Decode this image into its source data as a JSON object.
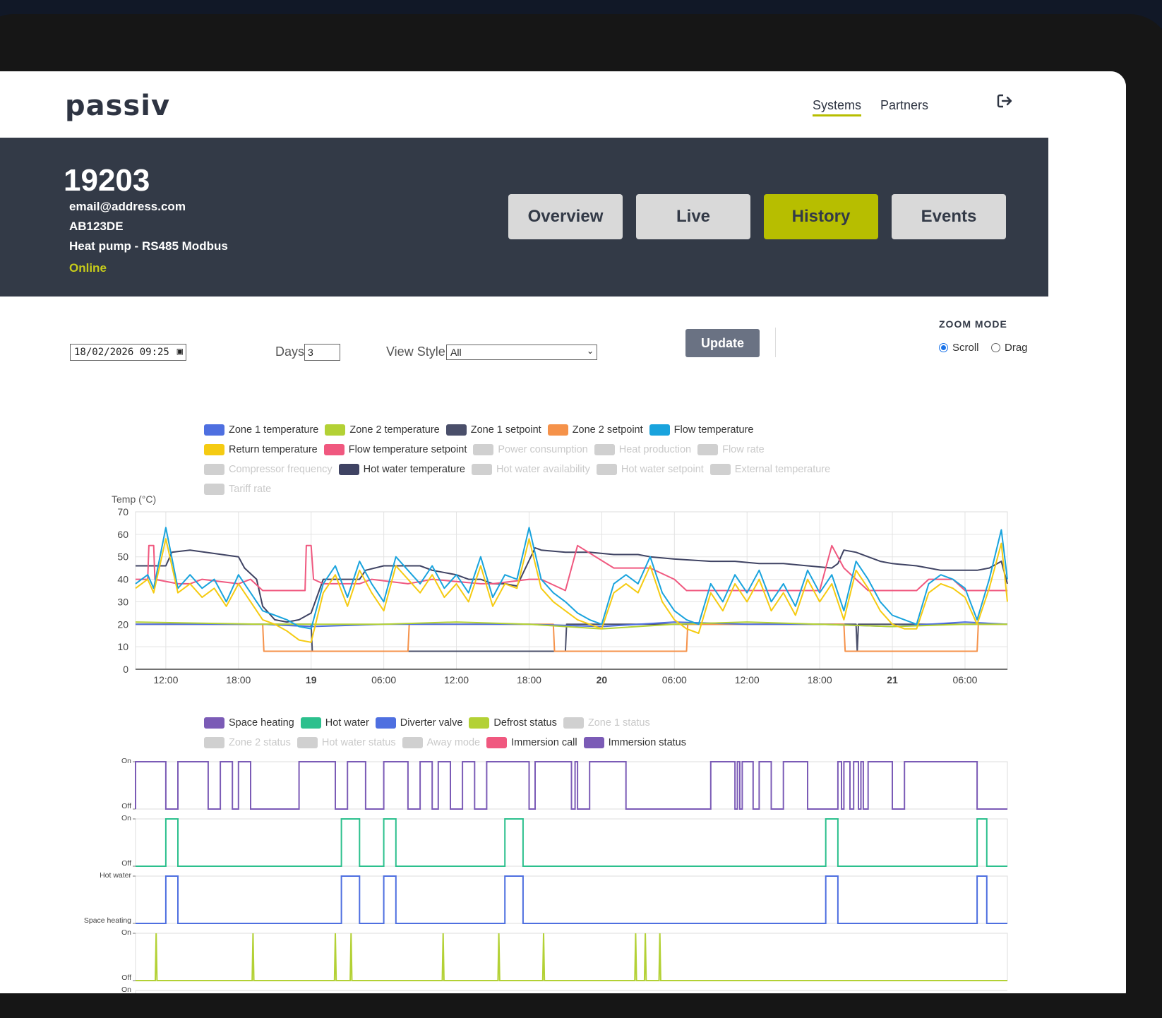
{
  "app": {
    "logo": "passiv"
  },
  "nav": {
    "systems": "Systems",
    "partners": "Partners",
    "logout_icon": "logout-icon"
  },
  "system": {
    "id": "19203",
    "email": "email@address.com",
    "postcode": "AB123DE",
    "device": "Heat pump - RS485 Modbus",
    "status": "Online"
  },
  "tabs": [
    {
      "label": "Overview",
      "active": false
    },
    {
      "label": "Live",
      "active": false
    },
    {
      "label": "History",
      "active": true
    },
    {
      "label": "Events",
      "active": false
    }
  ],
  "controls": {
    "date_value": "18/02/2026 09:25",
    "days_label": "Days",
    "days_value": "3",
    "view_style_label": "View Style",
    "view_style_value": "All",
    "update_label": "Update",
    "zoom_mode_title": "ZOOM MODE",
    "zoom_scroll": "Scroll",
    "zoom_drag": "Drag",
    "zoom_selected": "Scroll"
  },
  "colors": {
    "accent": "#b7be00",
    "header_bg": "#333a47"
  },
  "temp_legend": [
    {
      "label": "Zone 1 temperature",
      "color": "#4e6fe0",
      "on": true
    },
    {
      "label": "Zone 2 temperature",
      "color": "#b3d135",
      "on": true
    },
    {
      "label": "Zone 1 setpoint",
      "color": "#4a4f6a",
      "on": true
    },
    {
      "label": "Zone 2 setpoint",
      "color": "#f5924a",
      "on": true
    },
    {
      "label": "Flow temperature",
      "color": "#19a3dd",
      "on": true
    },
    {
      "label": "Return temperature",
      "color": "#f5cb12",
      "on": true
    },
    {
      "label": "Flow temperature setpoint",
      "color": "#f0587f",
      "on": true
    },
    {
      "label": "Power consumption",
      "color": "#d0d0d0",
      "on": false
    },
    {
      "label": "Heat production",
      "color": "#d0d0d0",
      "on": false
    },
    {
      "label": "Flow rate",
      "color": "#d0d0d0",
      "on": false
    },
    {
      "label": "Compressor frequency",
      "color": "#d0d0d0",
      "on": false
    },
    {
      "label": "Hot water temperature",
      "color": "#3f4363",
      "on": true
    },
    {
      "label": "Hot water availability",
      "color": "#d0d0d0",
      "on": false
    },
    {
      "label": "Hot water setpoint",
      "color": "#d0d0d0",
      "on": false
    },
    {
      "label": "External temperature",
      "color": "#d0d0d0",
      "on": false
    },
    {
      "label": "Tariff rate",
      "color": "#d0d0d0",
      "on": false
    }
  ],
  "status_legend": [
    {
      "label": "Space heating",
      "color": "#7b5bb6",
      "on": true
    },
    {
      "label": "Hot water",
      "color": "#2cc08d",
      "on": true
    },
    {
      "label": "Diverter valve",
      "color": "#4e6fe0",
      "on": true
    },
    {
      "label": "Defrost status",
      "color": "#b3d135",
      "on": true
    },
    {
      "label": "Zone 1 status",
      "color": "#d0d0d0",
      "on": false
    },
    {
      "label": "Zone 2 status",
      "color": "#d0d0d0",
      "on": false
    },
    {
      "label": "Hot water status",
      "color": "#d0d0d0",
      "on": false
    },
    {
      "label": "Away mode",
      "color": "#d0d0d0",
      "on": false
    },
    {
      "label": "Immersion call",
      "color": "#f0587f",
      "on": true
    },
    {
      "label": "Immersion status",
      "color": "#7b5bb6",
      "on": true
    }
  ],
  "chart_data": [
    {
      "type": "line",
      "ylabel": "Temp (°C)",
      "ylim": [
        0,
        70
      ],
      "yticks": [
        0,
        10,
        20,
        30,
        40,
        50,
        60,
        70
      ],
      "xticks": [
        {
          "label": "12:00",
          "bold": false
        },
        {
          "label": "18:00",
          "bold": false
        },
        {
          "label": "19",
          "bold": true
        },
        {
          "label": "06:00",
          "bold": false
        },
        {
          "label": "12:00",
          "bold": false
        },
        {
          "label": "18:00",
          "bold": false
        },
        {
          "label": "20",
          "bold": true
        },
        {
          "label": "06:00",
          "bold": false
        },
        {
          "label": "12:00",
          "bold": false
        },
        {
          "label": "18:00",
          "bold": false
        },
        {
          "label": "21",
          "bold": true
        },
        {
          "label": "06:00",
          "bold": false
        }
      ],
      "x_hours_from_12": [
        0,
        6,
        12,
        18,
        24,
        30,
        36,
        42,
        48,
        54,
        60,
        66
      ],
      "x_range_hours": [
        -2.5,
        69.5
      ],
      "grid": true,
      "series": [
        {
          "name": "Hot water temperature",
          "color": "#3f4363",
          "x": [
            -2.5,
            0,
            0.5,
            2,
            6,
            6.5,
            7.5,
            8,
            9,
            10,
            11,
            12,
            13,
            16,
            16.5,
            18,
            19,
            21,
            22,
            24,
            25,
            26,
            27,
            28,
            29,
            30.5,
            31,
            33,
            35,
            37,
            39,
            40,
            42,
            45,
            47,
            49,
            51,
            53,
            55,
            55.5,
            56,
            57,
            58,
            59,
            60,
            62,
            63,
            64,
            66,
            67,
            68,
            69,
            69.5
          ],
          "y": [
            46,
            46,
            52,
            53,
            50,
            45,
            40,
            28,
            22,
            21,
            22,
            25,
            40,
            40,
            44,
            46,
            46,
            46,
            44,
            42,
            40,
            40,
            38,
            38,
            37,
            54,
            53,
            52,
            52,
            51,
            51,
            50,
            49,
            48,
            48,
            47,
            47,
            46,
            45,
            47,
            53,
            52,
            50,
            48,
            47,
            46,
            45,
            44,
            44,
            44,
            45,
            48,
            38
          ]
        },
        {
          "name": "Zone 1 setpoint",
          "color": "#4a4f6a",
          "x": [
            -2.5,
            12,
            12.1,
            33,
            33.1,
            33.2,
            36,
            57,
            57.1,
            57.2,
            69.5
          ],
          "y": [
            20,
            20,
            8,
            8,
            20,
            20,
            20,
            20,
            8,
            20,
            20
          ]
        },
        {
          "name": "Zone 2 setpoint",
          "color": "#f5924a",
          "x": [
            -2.5,
            8,
            8.1,
            20,
            20.1,
            32,
            32.1,
            43,
            43.1,
            56,
            56.1,
            67,
            67.1,
            69.5
          ],
          "y": [
            20,
            20,
            8,
            8,
            20,
            20,
            8,
            8,
            20,
            20,
            8,
            8,
            20,
            20
          ]
        },
        {
          "name": "Zone 1 temperature",
          "color": "#4e6fe0",
          "x": [
            -2.5,
            8,
            12,
            18,
            24,
            30,
            36,
            42,
            48,
            54,
            60,
            66,
            69.5
          ],
          "y": [
            20,
            20,
            19,
            20,
            20,
            20,
            19,
            21,
            20,
            20,
            19,
            21,
            20
          ]
        },
        {
          "name": "Zone 2 temperature",
          "color": "#b3d135",
          "x": [
            -2.5,
            8,
            12,
            18,
            24,
            30,
            36,
            42,
            48,
            54,
            60,
            66,
            69.5
          ],
          "y": [
            21,
            20,
            20,
            20,
            21,
            20,
            18,
            20,
            21,
            20,
            19,
            20,
            20
          ]
        },
        {
          "name": "Flow temperature setpoint",
          "color": "#f0587f",
          "x": [
            -2.5,
            -1.5,
            -1.4,
            -1,
            -0.9,
            1,
            2,
            3,
            6,
            7,
            8,
            11.5,
            11.6,
            12,
            12.2,
            13,
            16,
            17,
            20,
            21,
            22,
            26,
            27,
            30,
            31,
            33,
            34,
            37,
            40,
            42,
            43,
            48,
            50,
            54,
            55,
            56,
            58,
            60,
            61,
            62,
            63,
            64,
            65,
            66,
            67,
            68,
            69.5
          ],
          "y": [
            40,
            40,
            55,
            55,
            40,
            38,
            38,
            40,
            38,
            40,
            35,
            35,
            55,
            55,
            40,
            38,
            38,
            40,
            38,
            39,
            40,
            38,
            38,
            40,
            40,
            35,
            55,
            45,
            45,
            40,
            35,
            35,
            35,
            35,
            55,
            45,
            35,
            35,
            35,
            35,
            40,
            40,
            40,
            35,
            35,
            35,
            35
          ]
        },
        {
          "name": "Flow temperature",
          "color": "#19a3dd",
          "x": [
            -2.5,
            -1.5,
            -1,
            0,
            1,
            2,
            3,
            4,
            5,
            6,
            7,
            8,
            9,
            10,
            11,
            12,
            13,
            14,
            15,
            16,
            17,
            18,
            19,
            20,
            21,
            22,
            23,
            24,
            25,
            26,
            27,
            28,
            29,
            30,
            31,
            32,
            33,
            34,
            35,
            36,
            37,
            38,
            39,
            40,
            41,
            42,
            43,
            44,
            45,
            46,
            47,
            48,
            49,
            50,
            51,
            52,
            53,
            54,
            55,
            56,
            57,
            58,
            59,
            60,
            61,
            62,
            63,
            64,
            65,
            66,
            67,
            68,
            69,
            69.5
          ],
          "y": [
            38,
            42,
            36,
            63,
            36,
            42,
            36,
            40,
            30,
            42,
            34,
            26,
            24,
            22,
            19,
            18,
            38,
            46,
            32,
            48,
            38,
            30,
            50,
            44,
            38,
            46,
            36,
            42,
            34,
            50,
            32,
            42,
            40,
            63,
            40,
            34,
            30,
            25,
            22,
            20,
            38,
            42,
            38,
            50,
            34,
            26,
            22,
            20,
            38,
            30,
            42,
            34,
            44,
            30,
            38,
            28,
            44,
            34,
            42,
            26,
            48,
            40,
            30,
            24,
            22,
            20,
            38,
            42,
            40,
            36,
            22,
            40,
            62,
            40
          ]
        },
        {
          "name": "Return temperature",
          "color": "#f5cb12",
          "x": [
            -2.5,
            -1.5,
            -1,
            0,
            1,
            2,
            3,
            4,
            5,
            6,
            7,
            8,
            9,
            10,
            11,
            12,
            13,
            14,
            15,
            16,
            17,
            18,
            19,
            20,
            21,
            22,
            23,
            24,
            25,
            26,
            27,
            28,
            29,
            30,
            31,
            32,
            33,
            34,
            35,
            36,
            37,
            38,
            39,
            40,
            41,
            42,
            43,
            44,
            45,
            46,
            47,
            48,
            49,
            50,
            51,
            52,
            53,
            54,
            55,
            56,
            57,
            58,
            59,
            60,
            61,
            62,
            63,
            64,
            65,
            66,
            67,
            68,
            69,
            69.5
          ],
          "y": [
            36,
            40,
            34,
            58,
            34,
            38,
            32,
            36,
            28,
            38,
            30,
            22,
            20,
            17,
            13,
            12,
            34,
            42,
            28,
            44,
            34,
            26,
            46,
            40,
            34,
            42,
            32,
            38,
            30,
            46,
            28,
            38,
            36,
            58,
            36,
            30,
            26,
            22,
            20,
            18,
            34,
            38,
            34,
            46,
            30,
            22,
            18,
            16,
            34,
            26,
            38,
            30,
            40,
            26,
            34,
            24,
            40,
            30,
            38,
            22,
            44,
            36,
            26,
            20,
            18,
            18,
            34,
            38,
            36,
            32,
            20,
            36,
            56,
            30
          ]
        }
      ]
    },
    {
      "type": "line",
      "title": "Space heating",
      "ylabels": [
        "On",
        "Off"
      ],
      "x_range_hours": [
        -2.5,
        69.5
      ],
      "series": [
        {
          "name": "Space heating",
          "color": "#7b5bb6",
          "on_intervals": [
            [
              -2.5,
              0
            ],
            [
              1,
              3.5
            ],
            [
              4.5,
              5.5
            ],
            [
              6,
              7
            ],
            [
              11,
              14
            ],
            [
              15,
              16.5
            ],
            [
              18,
              20
            ],
            [
              21,
              22
            ],
            [
              22.5,
              23.5
            ],
            [
              24.5,
              25.5
            ],
            [
              26.5,
              30
            ],
            [
              30.5,
              33.5
            ],
            [
              33.8,
              34
            ],
            [
              35,
              38
            ],
            [
              45,
              47
            ],
            [
              47.2,
              47.4
            ],
            [
              47.6,
              48.5
            ],
            [
              49,
              50
            ],
            [
              51,
              53
            ],
            [
              55.5,
              55.8
            ],
            [
              56,
              56.5
            ],
            [
              56.8,
              57.2
            ],
            [
              57.4,
              57.6
            ],
            [
              58,
              60
            ],
            [
              61,
              67
            ]
          ]
        }
      ]
    },
    {
      "type": "line",
      "title": "Hot water",
      "ylabels": [
        "On",
        "Off"
      ],
      "x_range_hours": [
        -2.5,
        69.5
      ],
      "series": [
        {
          "name": "Hot water",
          "color": "#2cc08d",
          "on_intervals": [
            [
              0,
              1
            ],
            [
              14.5,
              16
            ],
            [
              18,
              19
            ],
            [
              28,
              29.5
            ],
            [
              54.5,
              55.5
            ],
            [
              67,
              67.8
            ]
          ]
        }
      ]
    },
    {
      "type": "line",
      "title": "Diverter valve",
      "ylabels": [
        "Hot water",
        "Space heating"
      ],
      "x_range_hours": [
        -2.5,
        69.5
      ],
      "series": [
        {
          "name": "Diverter valve",
          "color": "#4e6fe0",
          "on_intervals": [
            [
              0,
              1
            ],
            [
              14.5,
              16
            ],
            [
              18,
              19
            ],
            [
              28,
              29.5
            ],
            [
              54.5,
              55.5
            ],
            [
              67,
              67.8
            ]
          ]
        }
      ]
    },
    {
      "type": "line",
      "title": "Defrost status",
      "ylabels": [
        "On",
        "Off"
      ],
      "x_range_hours": [
        -2.5,
        69.5
      ],
      "series": [
        {
          "name": "Defrost status",
          "color": "#b3d135",
          "on_pulses": [
            -0.8,
            7.2,
            14,
            15.3,
            22.9,
            27.5,
            31.2,
            38.8,
            39.6,
            40.8
          ]
        }
      ]
    }
  ]
}
